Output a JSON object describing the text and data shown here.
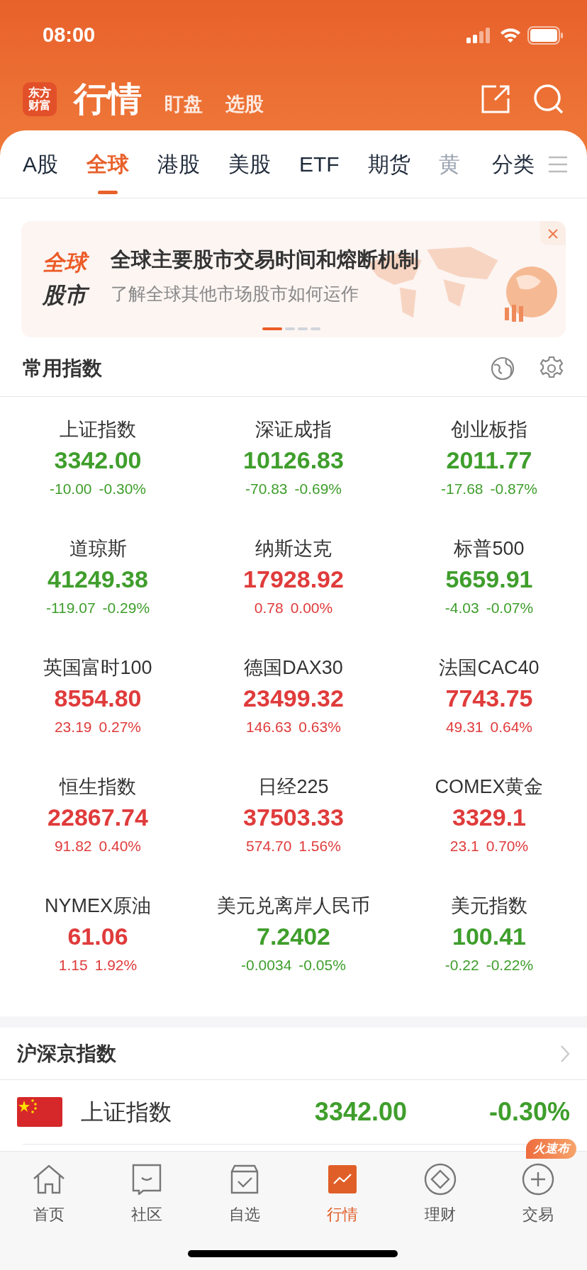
{
  "status_bar": {
    "time": "08:00"
  },
  "header": {
    "logo": "东方财富",
    "title": "行情",
    "links": [
      "盯盘",
      "选股"
    ]
  },
  "tabs": [
    {
      "label": "A股",
      "selected": false,
      "faded": false
    },
    {
      "label": "全球",
      "selected": true,
      "faded": false
    },
    {
      "label": "港股",
      "selected": false,
      "faded": false
    },
    {
      "label": "美股",
      "selected": false,
      "faded": false
    },
    {
      "label": "ETF",
      "selected": false,
      "faded": false
    },
    {
      "label": "期货",
      "selected": false,
      "faded": false
    },
    {
      "label": "黄",
      "selected": false,
      "faded": true
    }
  ],
  "category_tab": "分类",
  "banner": {
    "badge_top": "全球",
    "badge_bottom": "股市",
    "title": "全球主要股市交易时间和熔断机制",
    "subtitle": "了解全球其他市场股市如何运作",
    "pages": [
      {
        "selected": true
      },
      {
        "selected": false
      },
      {
        "selected": false
      },
      {
        "selected": false
      }
    ]
  },
  "common_indices": {
    "title": "常用指数",
    "items": [
      {
        "name": "上证指数",
        "value": "3342.00",
        "change": "-10.00",
        "percent": "-0.30%",
        "rising": false
      },
      {
        "name": "深证成指",
        "value": "10126.83",
        "change": "-70.83",
        "percent": "-0.69%",
        "rising": false
      },
      {
        "name": "创业板指",
        "value": "2011.77",
        "change": "-17.68",
        "percent": "-0.87%",
        "rising": false
      },
      {
        "name": "道琼斯",
        "value": "41249.38",
        "change": "-119.07",
        "percent": "-0.29%",
        "rising": false
      },
      {
        "name": "纳斯达克",
        "value": "17928.92",
        "change": "0.78",
        "percent": "0.00%",
        "rising": true
      },
      {
        "name": "标普500",
        "value": "5659.91",
        "change": "-4.03",
        "percent": "-0.07%",
        "rising": false
      },
      {
        "name": "英国富时100",
        "value": "8554.80",
        "change": "23.19",
        "percent": "0.27%",
        "rising": true
      },
      {
        "name": "德国DAX30",
        "value": "23499.32",
        "change": "146.63",
        "percent": "0.63%",
        "rising": true
      },
      {
        "name": "法国CAC40",
        "value": "7743.75",
        "change": "49.31",
        "percent": "0.64%",
        "rising": true
      },
      {
        "name": "恒生指数",
        "value": "22867.74",
        "change": "91.82",
        "percent": "0.40%",
        "rising": true
      },
      {
        "name": "日经225",
        "value": "37503.33",
        "change": "574.70",
        "percent": "1.56%",
        "rising": true
      },
      {
        "name": "COMEX黄金",
        "value": "3329.1",
        "change": "23.1",
        "percent": "0.70%",
        "rising": true
      },
      {
        "name": "NYMEX原油",
        "value": "61.06",
        "change": "1.15",
        "percent": "1.92%",
        "rising": true
      },
      {
        "name": "美元兑离岸人民币",
        "value": "7.2402",
        "change": "-0.0034",
        "percent": "-0.05%",
        "rising": false
      },
      {
        "name": "美元指数",
        "value": "100.41",
        "change": "-0.22",
        "percent": "-0.22%",
        "rising": false
      }
    ]
  },
  "domestic_indices": {
    "title": "沪深京指数",
    "rows": [
      {
        "name": "上证指数",
        "value": "3342.00",
        "percent": "-0.30%",
        "rising": false
      }
    ]
  },
  "bottom_nav": {
    "badge": "火速布",
    "items": [
      {
        "label": "首页",
        "selected": false
      },
      {
        "label": "社区",
        "selected": false
      },
      {
        "label": "自选",
        "selected": false
      },
      {
        "label": "行情",
        "selected": true
      },
      {
        "label": "理财",
        "selected": false
      },
      {
        "label": "交易",
        "selected": false
      }
    ]
  }
}
